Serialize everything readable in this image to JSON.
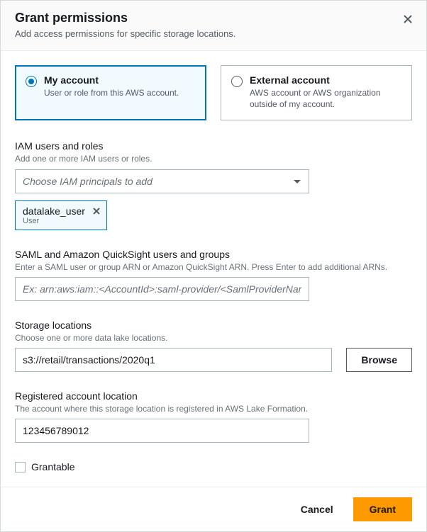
{
  "header": {
    "title": "Grant permissions",
    "subtitle": "Add access permissions for specific storage locations."
  },
  "account_choice": {
    "my_account": {
      "title": "My account",
      "desc": "User or role from this AWS account."
    },
    "external": {
      "title": "External account",
      "desc": "AWS account or AWS organization outside of my account."
    }
  },
  "iam": {
    "label": "IAM users and roles",
    "hint": "Add one or more IAM users or roles.",
    "placeholder": "Choose IAM principals to add",
    "token_name": "datalake_user",
    "token_type": "User"
  },
  "saml": {
    "label": "SAML and Amazon QuickSight users and groups",
    "hint": "Enter a SAML user or group ARN or Amazon QuickSight ARN. Press Enter to add additional ARNs.",
    "placeholder": "Ex: arn:aws:iam::<AccountId>:saml-provider/<SamlProviderName>"
  },
  "storage": {
    "label": "Storage locations",
    "hint": "Choose one or more data lake locations.",
    "value": "s3://retail/transactions/2020q1",
    "browse": "Browse"
  },
  "registered": {
    "label": "Registered account location",
    "hint": "The account where this storage location is registered in AWS Lake Formation.",
    "value": "123456789012"
  },
  "grantable_label": "Grantable",
  "footer": {
    "cancel": "Cancel",
    "grant": "Grant"
  }
}
